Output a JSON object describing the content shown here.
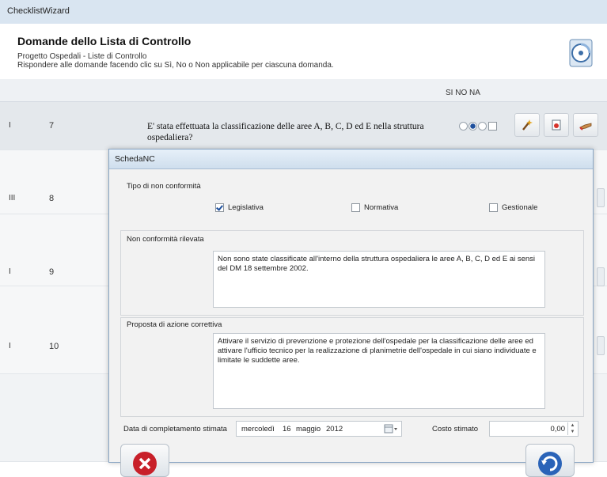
{
  "window": {
    "title": "ChecklistWizard"
  },
  "header": {
    "title": "Domande dello Lista di Controllo",
    "subtitle": "Progetto Ospedali - Liste di Controllo",
    "instructions": "Rispondere alle domande facendo clic su Sì, No o Non applicabile per ciascuna domanda."
  },
  "grid": {
    "columns_label": "SI  NO NA",
    "rows": [
      {
        "level": "I",
        "number": "7",
        "question": "E' stata effettuata la classificazione delle aree A, B, C, D ed E nella struttura ospedaliera?",
        "answer": "NO"
      },
      {
        "level": "III",
        "number": "8"
      },
      {
        "level": "I",
        "number": "9"
      },
      {
        "level": "I",
        "number": "10"
      }
    ]
  },
  "dialog": {
    "title": "SchedaNC",
    "type_label": "Tipo di non conformità",
    "types": [
      {
        "label": "Legislativa",
        "checked": true
      },
      {
        "label": "Normativa",
        "checked": false
      },
      {
        "label": "Gestionale",
        "checked": false
      }
    ],
    "detected_label": "Non conformità rilevata",
    "detected_text": "Non sono state classificate all'interno della struttura ospedaliera le aree A, B, C, D ed E ai sensi del DM 18 settembre 2002.",
    "action_label": "Proposta di azione correttiva",
    "action_text": "Attivare il servizio di prevenzione e protezione dell'ospedale per la classificazione delle aree ed attivare l'ufficio tecnico per la realizzazione di planimetrie dell'ospedale in cui siano individuate e limitate le suddette aree.",
    "date_label": "Data di completamento stimata",
    "date": {
      "weekday": "mercoledì",
      "day": "16",
      "month": "maggio",
      "year": "2012"
    },
    "cost_label": "Costo stimato",
    "cost_value": "0,00"
  },
  "icons": {
    "wizard": "cd-wizard-icon",
    "cancel": "cancel-icon",
    "confirm": "refresh-confirm-icon"
  },
  "colors": {
    "accent": "#1d4f9c",
    "cancel": "#c8202a",
    "confirm": "#2a63b8"
  }
}
